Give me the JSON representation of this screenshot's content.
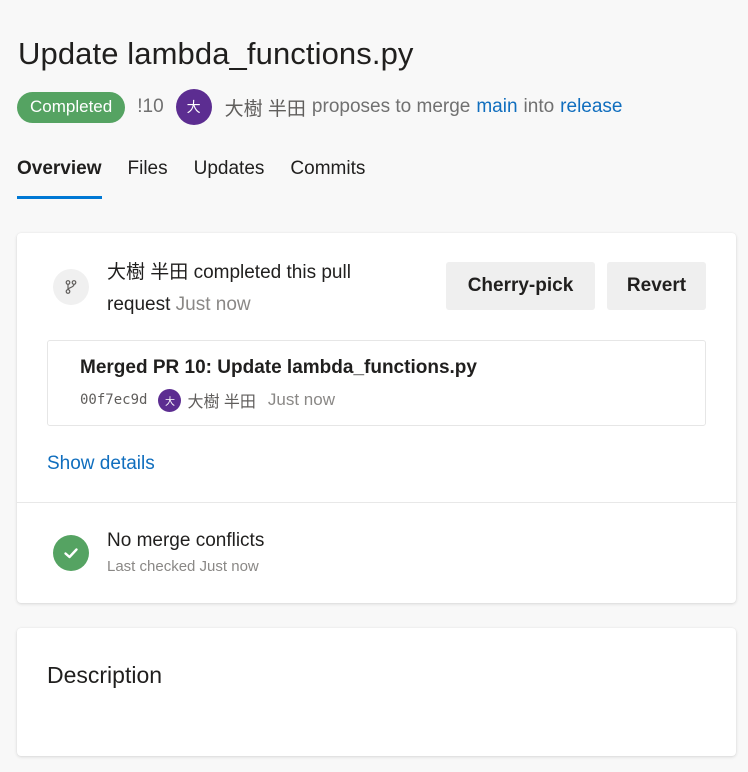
{
  "pr": {
    "title": "Update lambda_functions.py",
    "status": "Completed",
    "id": "!10",
    "author_initial": "大",
    "author": "大樹 半田",
    "proposes_text": "proposes to merge",
    "source_branch": "main",
    "into_text": "into",
    "target_branch": "release"
  },
  "tabs": [
    {
      "label": "Overview",
      "selected": true
    },
    {
      "label": "Files",
      "selected": false
    },
    {
      "label": "Updates",
      "selected": false
    },
    {
      "label": "Commits",
      "selected": false
    }
  ],
  "status_card": {
    "author": "大樹 半田",
    "action_text": "completed this pull request",
    "time": "Just now",
    "cherry_pick_label": "Cherry-pick",
    "revert_label": "Revert",
    "commit": {
      "title": "Merged PR 10: Update lambda_functions.py",
      "hash": "00f7ec9d",
      "author_initial": "大",
      "author": "大樹 半田",
      "time": "Just now"
    },
    "show_details_label": "Show details",
    "conflicts": {
      "title": "No merge conflicts",
      "subtitle": "Last checked Just now"
    }
  },
  "description_card": {
    "title": "Description"
  },
  "colors": {
    "status_green": "#55a362",
    "avatar_purple": "#5c2d91",
    "link_blue": "#106ebe",
    "tab_underline": "#0078d4"
  }
}
